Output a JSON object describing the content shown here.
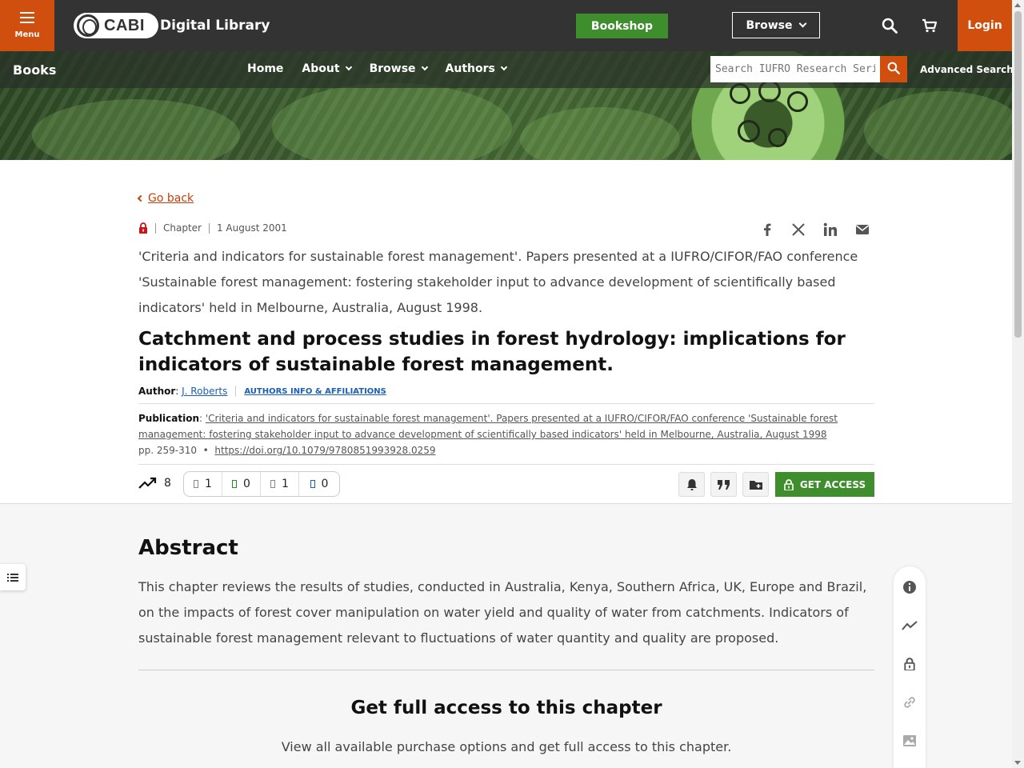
{
  "header": {
    "menu_label": "Menu",
    "logo_text": "CABI",
    "site_name": "Digital Library",
    "bookshop_label": "Bookshop",
    "browse_label": "Browse",
    "login_label": "Login"
  },
  "subnav": {
    "section_title": "Books",
    "links": [
      "Home",
      "About",
      "Browse",
      "Authors"
    ],
    "search_placeholder": "Search IUFRO Research Series",
    "advanced_search": "Advanced Search"
  },
  "article": {
    "go_back": "Go back",
    "type": "Chapter",
    "date": "1 August 2001",
    "book_description": "'Criteria and indicators for sustainable forest management'. Papers presented at a IUFRO/CIFOR/FAO conference 'Sustainable forest management: fostering stakeholder input to advance development of scientifically based indicators' held in Melbourne, Australia, August 1998.",
    "title": "Catchment and process studies in forest hydrology: implications for indicators of sustainable forest management.",
    "author_label": "Author",
    "author_name": "J. Roberts",
    "affiliations_label": "AUTHORS INFO & AFFILIATIONS",
    "publication_label": "Publication",
    "publication_text": "'Criteria and indicators for sustainable forest management'. Papers presented at a IUFRO/CIFOR/FAO conference 'Sustainable forest management: fostering stakeholder input to advance development of scientifically based indicators' held in Melbourne, Australia, August 1998",
    "pages": "pp. 259-310",
    "doi": "https://doi.org/10.1079/9780851993928.0259",
    "trend_count": "8",
    "metrics": [
      "1",
      "0",
      "1",
      "0"
    ],
    "get_access_label": "GET ACCESS"
  },
  "abstract": {
    "heading": "Abstract",
    "text": "This chapter reviews the results of studies, conducted in Australia, Kenya, Southern Africa, UK, Europe and Brazil, on the impacts of forest cover manipulation on water yield and quality of water from catchments. Indicators of sustainable forest management relevant to fluctuations of water quantity and quality are proposed."
  },
  "full_access": {
    "heading": "Get full access to this chapter",
    "text": "View all available purchase options and get full access to this chapter."
  },
  "colors": {
    "brand_orange": "#d14f0e",
    "brand_green": "#3e8e2d",
    "topbar": "#333333",
    "link_blue": "#1a5fb4"
  }
}
